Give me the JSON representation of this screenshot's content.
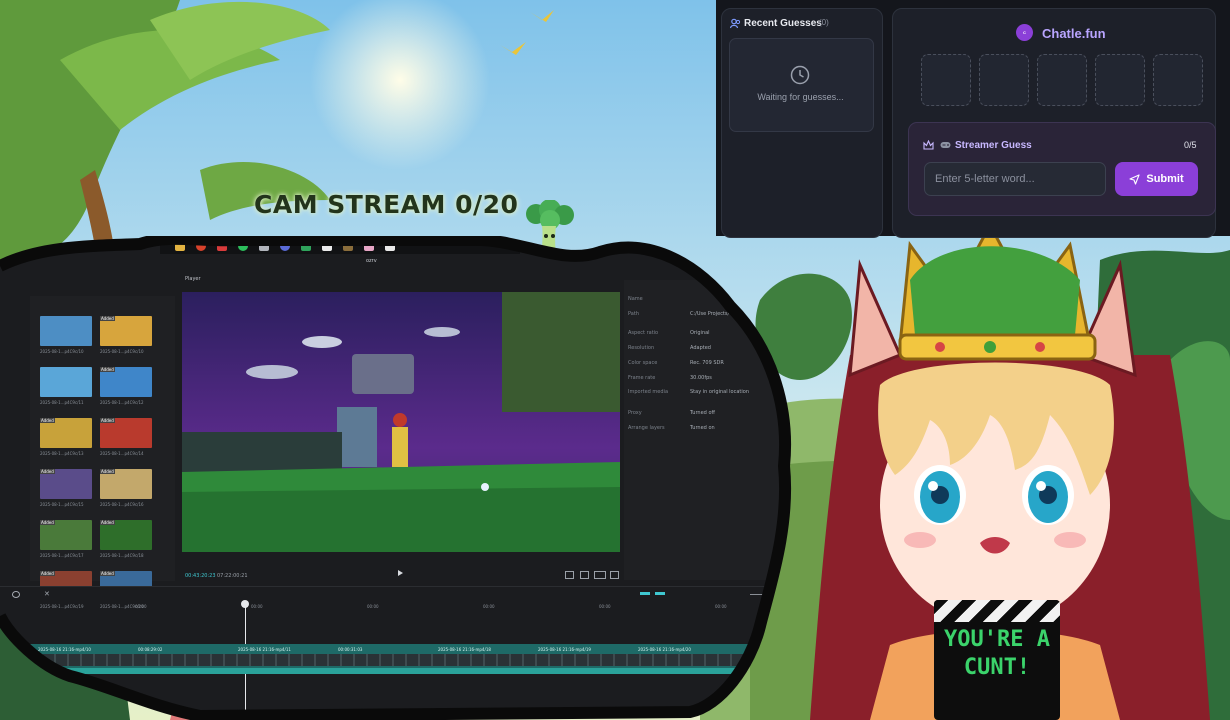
{
  "stream": {
    "title": "CAM STREAM 0/20"
  },
  "chatle": {
    "brand": "Chatle.fun",
    "recent_guesses": {
      "title": "Recent Guesses",
      "count": "(0)",
      "empty_text": "Waiting for guesses..."
    },
    "tiles": [
      "",
      "",
      "",
      "",
      ""
    ],
    "streamer_guess": {
      "title": "Streamer Guess",
      "count": "0/5",
      "input_placeholder": "Enter 5-letter word...",
      "input_value": "",
      "submit_label": "Submit"
    },
    "accent_color": "#8b3fd8"
  },
  "editor": {
    "window_title": "ozrv",
    "player_label": "Player",
    "time_current": "00:43:20:23",
    "time_total": "07:22:00:21",
    "media_items": [
      {
        "label": "2025-08-1...p4C9c/10",
        "added": false
      },
      {
        "label": "2025-08-1...p4C9c/10",
        "added": true
      },
      {
        "label": "2025-08-1...p4C9c/11",
        "added": false
      },
      {
        "label": "2025-08-1...p4C9c/12",
        "added": true
      },
      {
        "label": "2025-08-1...p4C9c/13",
        "added": true
      },
      {
        "label": "2025-08-1...p4C9c/14",
        "added": true
      },
      {
        "label": "2025-08-1...p4C9c/15",
        "added": true
      },
      {
        "label": "2025-08-1...p4C9c/16",
        "added": true
      },
      {
        "label": "2025-08-1...p4C9c/17",
        "added": true
      },
      {
        "label": "2025-08-1...p4C9c/18",
        "added": true
      },
      {
        "label": "2025-08-1...p4C9c/19",
        "added": true
      },
      {
        "label": "2025-08-1...p4C9c/20",
        "added": true
      }
    ],
    "properties": [
      {
        "name": "Name",
        "value": ""
      },
      {
        "name": "Path",
        "value": "C:/Use Projects/"
      },
      {
        "name": "Aspect ratio",
        "value": "Original"
      },
      {
        "name": "Resolution",
        "value": "Adapted"
      },
      {
        "name": "Color space",
        "value": "Rec. 709 SDR"
      },
      {
        "name": "Frame rate",
        "value": "30.00fps"
      },
      {
        "name": "Imported media",
        "value": "Stay in original location"
      },
      {
        "name": "Proxy",
        "value": "Turned off"
      },
      {
        "name": "Arrange layers",
        "value": "Turned on"
      }
    ],
    "ruler_marks": [
      "00:00",
      "00:00",
      "00:00",
      "00:00",
      "00:00",
      "00:00"
    ],
    "clip_labels": [
      "2025-08-16 21:16-mp4/10",
      "00:08:29:02",
      "2025-08-16 21:16-mp4/11",
      "00:00:31:03",
      "2025-08-16 21:16-mp4/18",
      "2025-08-16 21:16-mp4/19",
      "2025-08-16 21:16-mp4/20"
    ]
  },
  "overlay_sign": {
    "text": "YOU'RE A CUNT!"
  }
}
